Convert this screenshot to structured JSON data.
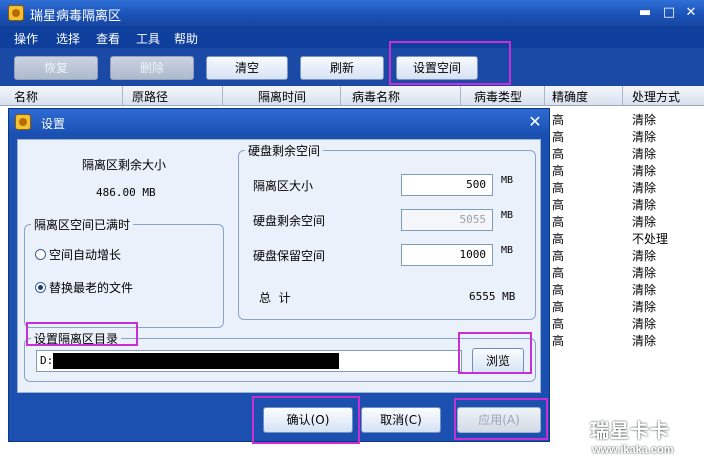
{
  "app": {
    "title": "瑞星病毒隔离区"
  },
  "menu": [
    "操作",
    "选择",
    "查看",
    "工具",
    "帮助"
  ],
  "toolbar": {
    "restore": "恢复",
    "delete": "删除",
    "clear": "清空",
    "refresh": "刷新",
    "settings": "设置空间"
  },
  "columns": [
    "名称",
    "原路径",
    "隔离时间",
    "病毒名称",
    "病毒类型",
    "精确度",
    "处理方式"
  ],
  "rows": [
    {
      "accuracy": "高",
      "action": "清除"
    },
    {
      "accuracy": "高",
      "action": "清除"
    },
    {
      "accuracy": "高",
      "action": "清除"
    },
    {
      "accuracy": "高",
      "action": "清除"
    },
    {
      "accuracy": "高",
      "action": "清除"
    },
    {
      "accuracy": "高",
      "action": "清除"
    },
    {
      "accuracy": "高",
      "action": "清除"
    },
    {
      "accuracy": "高",
      "action": "不处理"
    },
    {
      "accuracy": "高",
      "action": "清除"
    },
    {
      "accuracy": "高",
      "action": "清除"
    },
    {
      "accuracy": "高",
      "action": "清除"
    },
    {
      "accuracy": "高",
      "action": "清除"
    },
    {
      "accuracy": "高",
      "action": "清除"
    },
    {
      "accuracy": "高",
      "action": "清除"
    }
  ],
  "dialog": {
    "title": "设置",
    "remaining_label": "隔离区剩余大小",
    "remaining_value": "486.00 MB",
    "full_group": "隔离区空间已满时",
    "opt_auto_grow": "空间自动增长",
    "opt_replace_oldest": "替换最老的文件",
    "disk_group": "硬盘剩余空间",
    "quarantine_size_label": "隔离区大小",
    "quarantine_size_value": "500",
    "disk_free_label": "硬盘剩余空间",
    "disk_free_value": "5055",
    "disk_reserve_label": "硬盘保留空间",
    "disk_reserve_value": "1000",
    "unit": "MB",
    "total_label": "总  计",
    "total_value": "6555 MB",
    "dir_group": "设置隔离区目录",
    "dir_prefix": "D:",
    "browse": "浏览",
    "ok": "确认(O)",
    "cancel": "取消(C)",
    "apply": "应用(A)"
  },
  "watermark": {
    "brand": "瑞星卡卡",
    "url": "www.ikaka.com"
  },
  "colors": {
    "highlight": "#c62fd3",
    "titlebar": "#1b52b8"
  }
}
